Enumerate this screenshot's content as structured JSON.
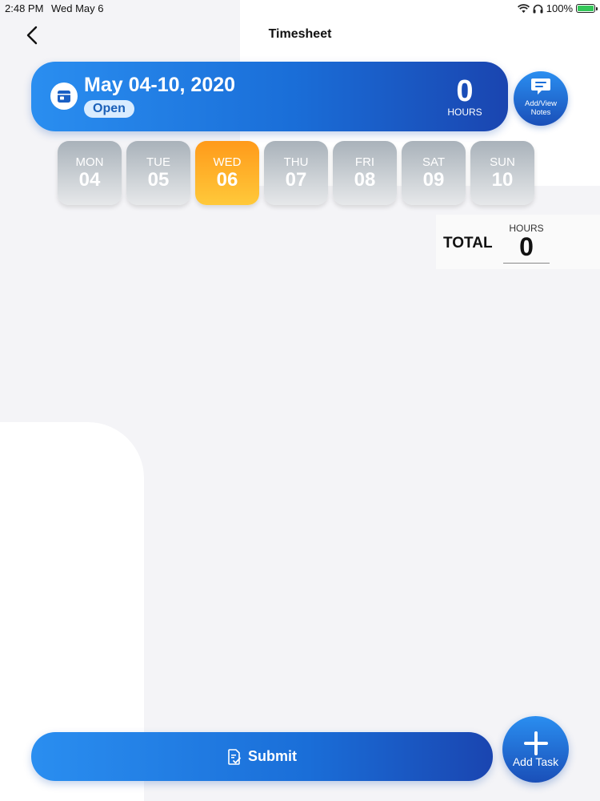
{
  "status_bar": {
    "time": "2:48 PM",
    "date": "Wed May 6",
    "battery": "100%"
  },
  "header": {
    "title": "Timesheet"
  },
  "week": {
    "range": "May 04-10, 2020",
    "status": "Open",
    "hours": "0",
    "hours_label": "HOURS"
  },
  "notes_button": {
    "line1": "Add/View",
    "line2": "Notes"
  },
  "days": [
    {
      "name": "MON",
      "num": "04"
    },
    {
      "name": "TUE",
      "num": "05"
    },
    {
      "name": "WED",
      "num": "06"
    },
    {
      "name": "THU",
      "num": "07"
    },
    {
      "name": "FRI",
      "num": "08"
    },
    {
      "name": "SAT",
      "num": "09"
    },
    {
      "name": "SUN",
      "num": "10"
    }
  ],
  "selected_day": "WED",
  "total": {
    "label": "TOTAL",
    "hours_label": "HOURS",
    "hours": "0"
  },
  "submit": {
    "label": "Submit"
  },
  "add_task": {
    "label": "Add Task"
  },
  "colors": {
    "primary": "#1a6ed8",
    "active_day": "#ffb020",
    "inactive_day": "#b5bcc3"
  }
}
